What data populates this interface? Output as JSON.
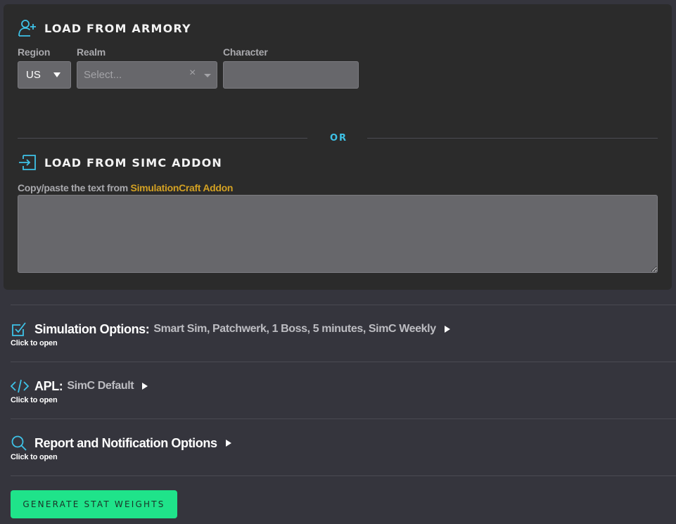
{
  "armory": {
    "title": "LOAD FROM ARMORY",
    "region_label": "Region",
    "region_value": "US",
    "realm_label": "Realm",
    "realm_placeholder": "Select...",
    "realm_clear": "×",
    "character_label": "Character",
    "character_value": ""
  },
  "divider": {
    "or_text": "OR"
  },
  "simc": {
    "title": "LOAD FROM SIMC ADDON",
    "hint_prefix": "Copy/paste the text from ",
    "hint_link": "SimulationCraft Addon",
    "textarea_value": ""
  },
  "options": [
    {
      "title": "Simulation Options:",
      "summary": "Smart Sim, Patchwerk, 1 Boss, 5 minutes, SimC Weekly",
      "click_hint": "Click to open",
      "icon": "checkbox-icon"
    },
    {
      "title": "APL:",
      "summary": "SimC Default",
      "click_hint": "Click to open",
      "icon": "code-icon"
    },
    {
      "title": "Report and Notification Options",
      "summary": "",
      "click_hint": "Click to open",
      "icon": "search-icon"
    }
  ],
  "generate_button": "GENERATE STAT WEIGHTS",
  "colors": {
    "accent": "#3ec2e7",
    "link": "#d3a123",
    "button": "#1fe38a"
  }
}
